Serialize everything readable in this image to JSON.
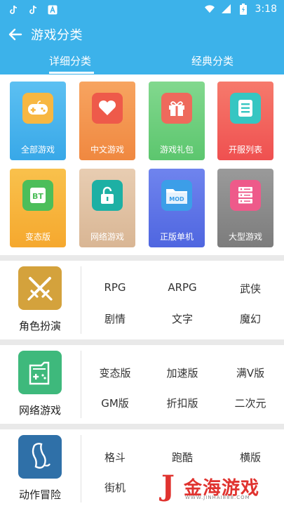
{
  "status": {
    "time": "3:18"
  },
  "header": {
    "title": "游戏分类"
  },
  "tabs": [
    {
      "label": "详细分类",
      "active": true
    },
    {
      "label": "经典分类",
      "active": false
    }
  ],
  "categories": [
    {
      "label": "全部游戏",
      "icon": "gamepad-icon",
      "bg": "#42b1ec",
      "icon_bg": "#f7b742"
    },
    {
      "label": "中文游戏",
      "icon": "heart-icon",
      "bg": "#f39450",
      "icon_bg": "#ee5a4a"
    },
    {
      "label": "游戏礼包",
      "icon": "gift-icon",
      "bg": "#6fcf7f",
      "icon_bg": "#ee6a5c"
    },
    {
      "label": "开服列表",
      "icon": "server-list-icon",
      "bg": "#f3605a",
      "icon_bg": "#36c6c2"
    },
    {
      "label": "变态版",
      "icon": "bt-icon",
      "bg": "#f7b23b",
      "icon_bg": "#4cbe5a"
    },
    {
      "label": "网络游戏",
      "icon": "unlock-icon",
      "bg": "#e0c2a4",
      "icon_bg": "#1db0a4"
    },
    {
      "label": "正版单机",
      "icon": "mod-folder-icon",
      "bg": "#5a72e8",
      "icon_bg": "#3c9ee8"
    },
    {
      "label": "大型游戏",
      "icon": "server-rack-icon",
      "bg": "#8c8c8c",
      "icon_bg": "#ee5a8a"
    }
  ],
  "sections": [
    {
      "title": "角色扮演",
      "icon": "crossed-swords-icon",
      "icon_bg": "#d4a23c",
      "items": [
        "RPG",
        "ARPG",
        "武侠",
        "剧情",
        "文字",
        "魔幻"
      ]
    },
    {
      "title": "网络游戏",
      "icon": "console-device-icon",
      "icon_bg": "#3eb97c",
      "items": [
        "变态版",
        "加速版",
        "满V版",
        "GM版",
        "折扣版",
        "二次元"
      ]
    },
    {
      "title": "动作冒险",
      "icon": "foot-icon",
      "icon_bg": "#2f70a8",
      "items": [
        "格斗",
        "跑酷",
        "横版",
        "街机"
      ]
    }
  ],
  "watermark": {
    "mark": "J",
    "text": "金海游戏",
    "sub": "WWW.JINHAI888.COM"
  }
}
